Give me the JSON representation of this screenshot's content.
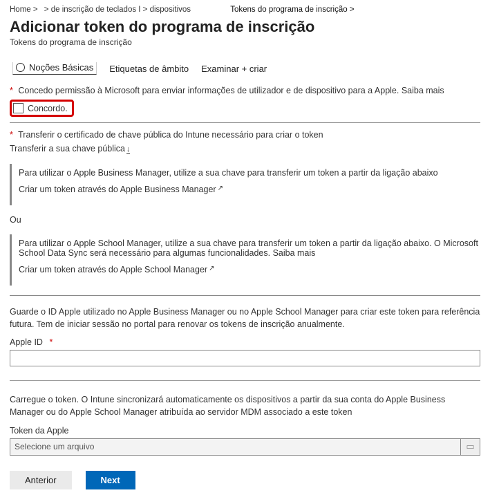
{
  "breadcrumb": {
    "c1": "Home >",
    "c2": "> de inscrição de teclados I > dispositivos",
    "c3": "Tokens do programa de inscrição >"
  },
  "page": {
    "title": "Adicionar token do programa de inscrição",
    "subtitle": "Tokens do programa de inscrição"
  },
  "tabs": {
    "t1": "Noções Básicas",
    "t2": "Etiquetas de âmbito",
    "t3": "Examinar + criar"
  },
  "permission": {
    "label": "Concedo permissão à Microsoft para enviar informações de utilizador e de dispositivo para a Apple. Saiba mais",
    "agree": "Concordo."
  },
  "transfer": {
    "label": "Transferir o certificado de chave pública do Intune necessário para criar o token",
    "link": "Transferir a sua chave pública"
  },
  "abm": {
    "desc": "Para utilizar o Apple Business Manager, utilize a sua chave para transferir um token a partir da ligação abaixo",
    "link": "Criar um token através do Apple Business Manager"
  },
  "ou": "Ou",
  "asm": {
    "desc": "Para utilizar o Apple School Manager, utilize a sua chave para transferir um token a partir da ligação abaixo. O Microsoft School Data Sync será necessário para algumas funcionalidades. Saiba mais",
    "link": "Criar um token através do Apple School Manager"
  },
  "appleid": {
    "desc": "Guarde o ID Apple utilizado no Apple Business Manager ou no Apple School Manager para criar este token para referência futura. Tem de iniciar sessão no portal para renovar os tokens de inscrição anualmente.",
    "label": "Apple ID"
  },
  "token": {
    "desc": "Carregue o token. O Intune sincronizará automaticamente os dispositivos a partir da sua conta do Apple Business Manager ou do Apple School Manager atribuída ao servidor MDM associado a este token",
    "label": "Token da Apple",
    "placeholder": "Selecione um arquivo"
  },
  "buttons": {
    "prev": "Anterior",
    "next": "Next"
  }
}
